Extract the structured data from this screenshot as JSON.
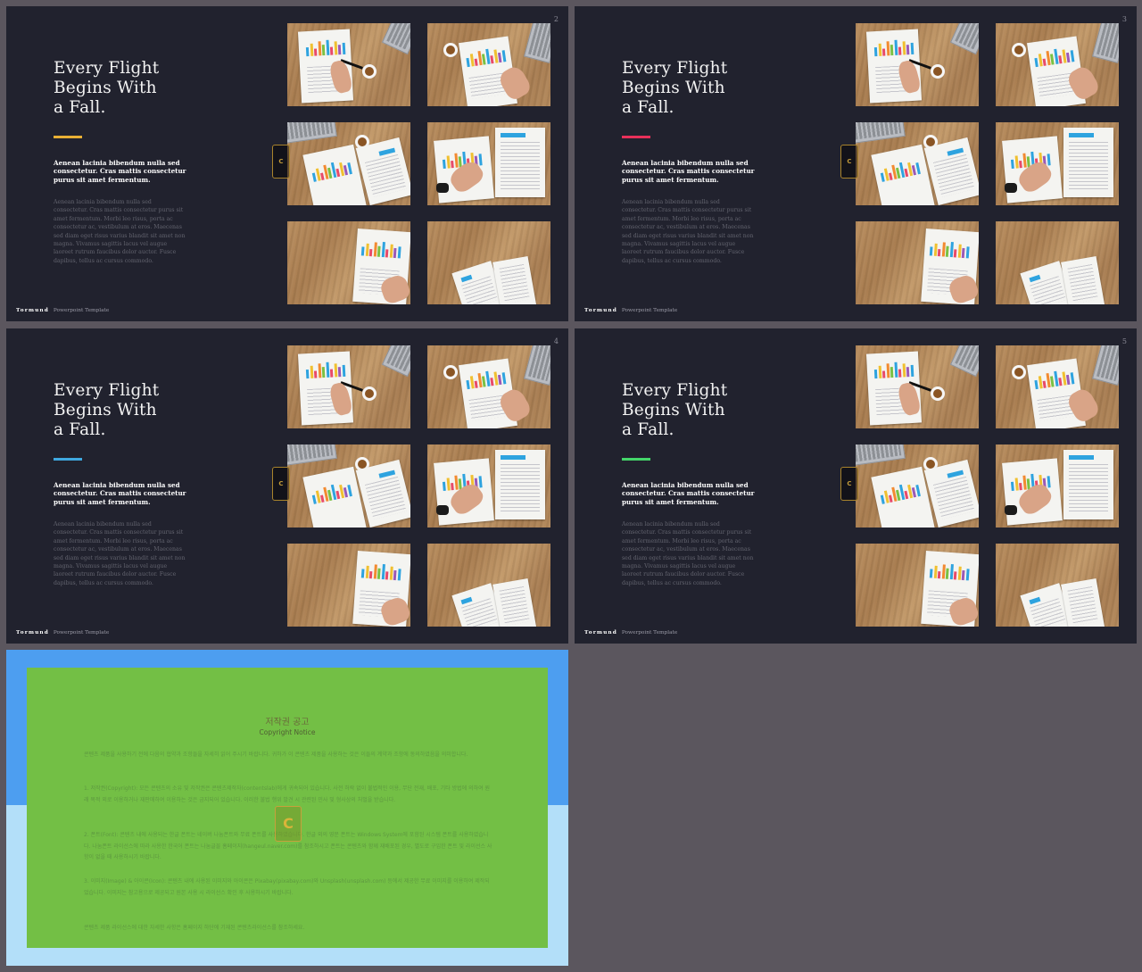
{
  "colors": {
    "background": "#5b565e",
    "slide_bg": "#21222e",
    "accents": [
      "#e9b035",
      "#e8305a",
      "#3fa9e0",
      "#44d66a"
    ],
    "notice_blue": "#4d9ef0",
    "notice_lightblue": "#b3dff9",
    "notice_green": "#73bf45"
  },
  "slides": [
    {
      "number": "2",
      "title_lines": [
        "Every Flight",
        "Begins With",
        "a Fall."
      ],
      "lead": "Aenean lacinia bibendum nulla sed consectetur. Cras mattis consectetur purus sit amet fermentum.",
      "body": "Aenean lacinia bibendum nulla sed consectetur. Cras mattis consectetur purus sit amet fermentum. Morbi leo risus, porta ac consectetur ac, vestibulum at eros. Maecenas sed diam eget risus varius blandit sit amet non magna. Vivamus sagittis lacus vel augue laoreet rutrum faucibus dolor auctor. Fusce dapibus, tellus ac cursus commodo.",
      "footer_brand": "Tormund",
      "footer_text": "Powerpoint  Template",
      "accent": "#e9b035"
    },
    {
      "number": "3",
      "title_lines": [
        "Every Flight",
        "Begins With",
        "a Fall."
      ],
      "lead": "Aenean lacinia bibendum nulla sed consectetur. Cras mattis consectetur purus sit amet fermentum.",
      "body": "Aenean lacinia bibendum nulla sed consectetur. Cras mattis consectetur purus sit amet fermentum. Morbi leo risus, porta ac consectetur ac, vestibulum at eros. Maecenas sed diam eget risus varius blandit sit amet non magna. Vivamus sagittis lacus vel augue laoreet rutrum faucibus dolor auctor. Fusce dapibus, tellus ac cursus commodo.",
      "footer_brand": "Tormund",
      "footer_text": "Powerpoint  Template",
      "accent": "#e8305a"
    },
    {
      "number": "4",
      "title_lines": [
        "Every Flight",
        "Begins With",
        "a Fall."
      ],
      "lead": "Aenean lacinia bibendum nulla sed consectetur. Cras mattis consectetur purus sit amet fermentum.",
      "body": "Aenean lacinia bibendum nulla sed consectetur. Cras mattis consectetur purus sit amet fermentum. Morbi leo risus, porta ac consectetur ac, vestibulum at eros. Maecenas sed diam eget risus varius blandit sit amet non magna. Vivamus sagittis lacus vel augue laoreet rutrum faucibus dolor auctor. Fusce dapibus, tellus ac cursus commodo.",
      "footer_brand": "Tormund",
      "footer_text": "Powerpoint  Template",
      "accent": "#3fa9e0"
    },
    {
      "number": "5",
      "title_lines": [
        "Every Flight",
        "Begins With",
        "a Fall."
      ],
      "lead": "Aenean lacinia bibendum nulla sed consectetur. Cras mattis consectetur purus sit amet fermentum.",
      "body": "Aenean lacinia bibendum nulla sed consectetur. Cras mattis consectetur purus sit amet fermentum. Morbi leo risus, porta ac consectetur ac, vestibulum at eros. Maecenas sed diam eget risus varius blandit sit amet non magna. Vivamus sagittis lacus vel augue laoreet rutrum faucibus dolor auctor. Fusce dapibus, tellus ac cursus commodo.",
      "footer_brand": "Tormund",
      "footer_text": "Powerpoint  Template",
      "accent": "#44d66a"
    }
  ],
  "notice": {
    "title": "저작권 공고",
    "subtitle": "Copyright Notice",
    "paragraphs": [
      "콘텐츠 제품을 사용하기 전에 다음의 협약과 조항들을 자세히 읽어 주시기 바랍니다. 귀하가 이 콘텐츠 제품을 사용하는 것은 이들의 계약과 조항에 동의하였음을 의미합니다.",
      "1. 저작권(Copyright): 모든 콘텐츠의 소유 및 저작권은 콘텐츠제작자(contentslab)에게 귀속되어 있습니다. 사전 허락 없이 불법적인 이용, 무단 전재, 배포, 기타 방법에 의하여 원래 목적 외로 이용하거나 재판매하여 이용하는 것은 금지되어 있습니다. 이러한 불법 행위 발견 시 관련된 민사 및 형사상의 처벌을 받습니다.",
      "2. 폰트(Font): 콘텐츠 내에 사용되는 한글 폰트는 네이버 나눔폰트와 무료 폰트를 사용하였습니다. 한글 외의 영문 폰트는 Windows System에 포함된 시스템 폰트를 사용하였습니다. 나눔폰트 라이선스에 따라 사용한 한국어 폰트는 나눔글꼴 홈페이지(hangeul.naver.com)를 참조하시고 폰트는 콘텐츠와 함께 재배포된 경우, 별도로 구입한 폰트 및 라이선스 사항이 없을 때 사용하시기 바랍니다.",
      "3. 이미지(Image) & 아이콘(Icon): 콘텐츠 내에 사용된 이미지와 아이콘은 Pixabay(pixabay.com)와 Unsplash(unsplash.com) 등에서 제공한 무료 이미지를 이용하여 제작되었습니다. 이미지는 참고용으로 제공되고 원본 사용 시 라이선스 확인 후 사용하시기 바랍니다.",
      "콘텐츠 제품 라이선스에 대한 자세한 사항은 홈페이지 하단에 기재된 콘텐츠라이선스를 참조하세요."
    ]
  },
  "logo_letter": "C"
}
